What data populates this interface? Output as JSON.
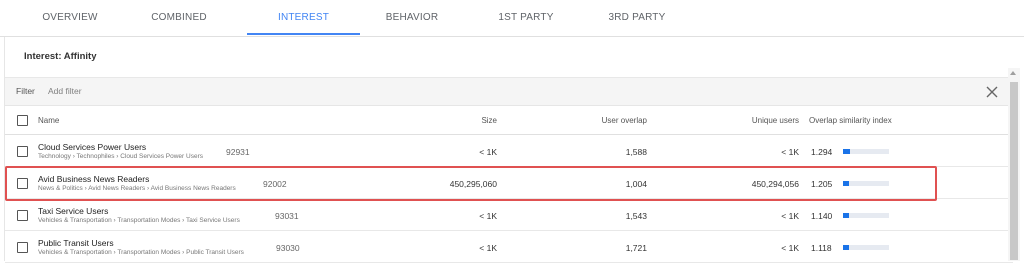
{
  "tabs": [
    {
      "label": "OVERVIEW",
      "active": false
    },
    {
      "label": "COMBINED",
      "active": false
    },
    {
      "label": "INTEREST",
      "active": true
    },
    {
      "label": "BEHAVIOR",
      "active": false
    },
    {
      "label": "1ST PARTY",
      "active": false
    },
    {
      "label": "3RD PARTY",
      "active": false
    }
  ],
  "panel": {
    "title": "Interest: Affinity"
  },
  "filter": {
    "label": "Filter",
    "placeholder": "Add filter"
  },
  "table": {
    "columns": {
      "name": "Name",
      "size": "Size",
      "overlap": "User overlap",
      "unique": "Unique users",
      "index": "Overlap similarity index"
    },
    "rows": [
      {
        "name": "Cloud Services Power Users",
        "path": "Technology › Technophiles › Cloud Services Power Users",
        "id": "92931",
        "size": "< 1K",
        "overlap": "1,588",
        "unique": "< 1K",
        "index": "1.294",
        "index_fill": 0.15,
        "highlighted": false
      },
      {
        "name": "Avid Business News Readers",
        "path": "News & Politics › Avid News Readers › Avid Business News Readers",
        "id": "92002",
        "size": "450,295,060",
        "overlap": "1,004",
        "unique": "450,294,056",
        "index": "1.205",
        "index_fill": 0.13,
        "highlighted": true
      },
      {
        "name": "Taxi Service Users",
        "path": "Vehicles & Transportation › Transportation Modes › Taxi Service Users",
        "id": "93031",
        "size": "< 1K",
        "overlap": "1,543",
        "unique": "< 1K",
        "index": "1.140",
        "index_fill": 0.12,
        "highlighted": false
      },
      {
        "name": "Public Transit Users",
        "path": "Vehicles & Transportation › Transportation Modes › Public Transit Users",
        "id": "93030",
        "size": "< 1K",
        "overlap": "1,721",
        "unique": "< 1K",
        "index": "1.118",
        "index_fill": 0.12,
        "highlighted": false
      }
    ]
  },
  "colors": {
    "accent": "#4285f4",
    "bar": "#1a73e8",
    "highlight": "#e05151"
  }
}
